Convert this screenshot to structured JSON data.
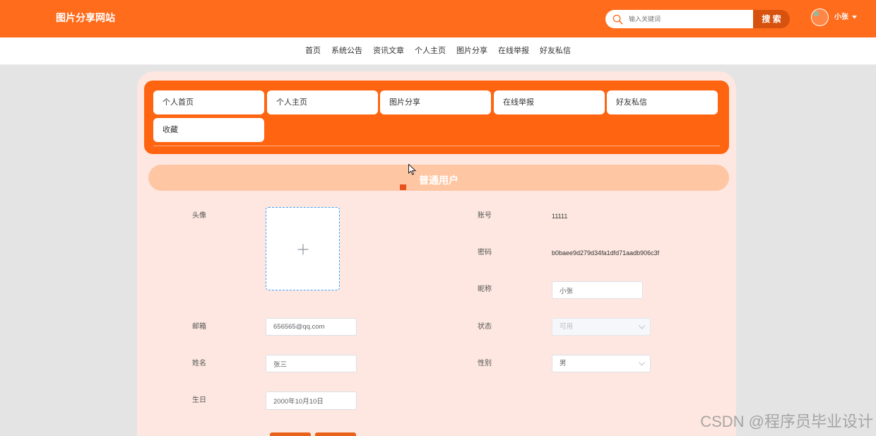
{
  "theme": {
    "primary": "#ff6c1c",
    "menu_bg": "#ff6510",
    "search_button": "#d6520e",
    "panel_bg": "#fde7e0",
    "role_banner_bg": "#ffc6a4",
    "action_button": "#e8621c",
    "upload_border": "#409eff"
  },
  "header": {
    "site_title": "图片分享网站",
    "search": {
      "placeholder": "输入关键词",
      "button_label": "搜 索",
      "icon": "search-icon"
    },
    "user": {
      "name": "小张",
      "avatar_icon": "avatar",
      "menu_icon": "caret-down-icon"
    }
  },
  "nav": {
    "items": [
      "首页",
      "系统公告",
      "资讯文章",
      "个人主页",
      "图片分享",
      "在线举报",
      "好友私信"
    ]
  },
  "center_menu": {
    "items": [
      "个人首页",
      "个人主页",
      "图片分享",
      "在线举报",
      "好友私信",
      "收藏"
    ]
  },
  "role_banner": {
    "label": "普通用户"
  },
  "profile_form": {
    "avatar": {
      "label": "头像",
      "upload_icon": "plus-icon"
    },
    "email": {
      "label": "邮箱",
      "value": "656565@qq.com"
    },
    "name": {
      "label": "姓名",
      "value": "张三"
    },
    "birthday": {
      "label": "生日",
      "value": "2000年10月10日"
    },
    "account": {
      "label": "账号",
      "value": "11111"
    },
    "password": {
      "label": "密码",
      "value": "b0baee9d279d34fa1dfd71aadb906c3f"
    },
    "nickname": {
      "label": "昵称",
      "value": "小张"
    },
    "status": {
      "label": "状态",
      "value": "可用",
      "disabled": true,
      "icon": "chevron-down-icon"
    },
    "gender": {
      "label": "性别",
      "value": "男",
      "icon": "chevron-down-icon"
    }
  },
  "watermark": "CSDN @程序员毕业设计"
}
